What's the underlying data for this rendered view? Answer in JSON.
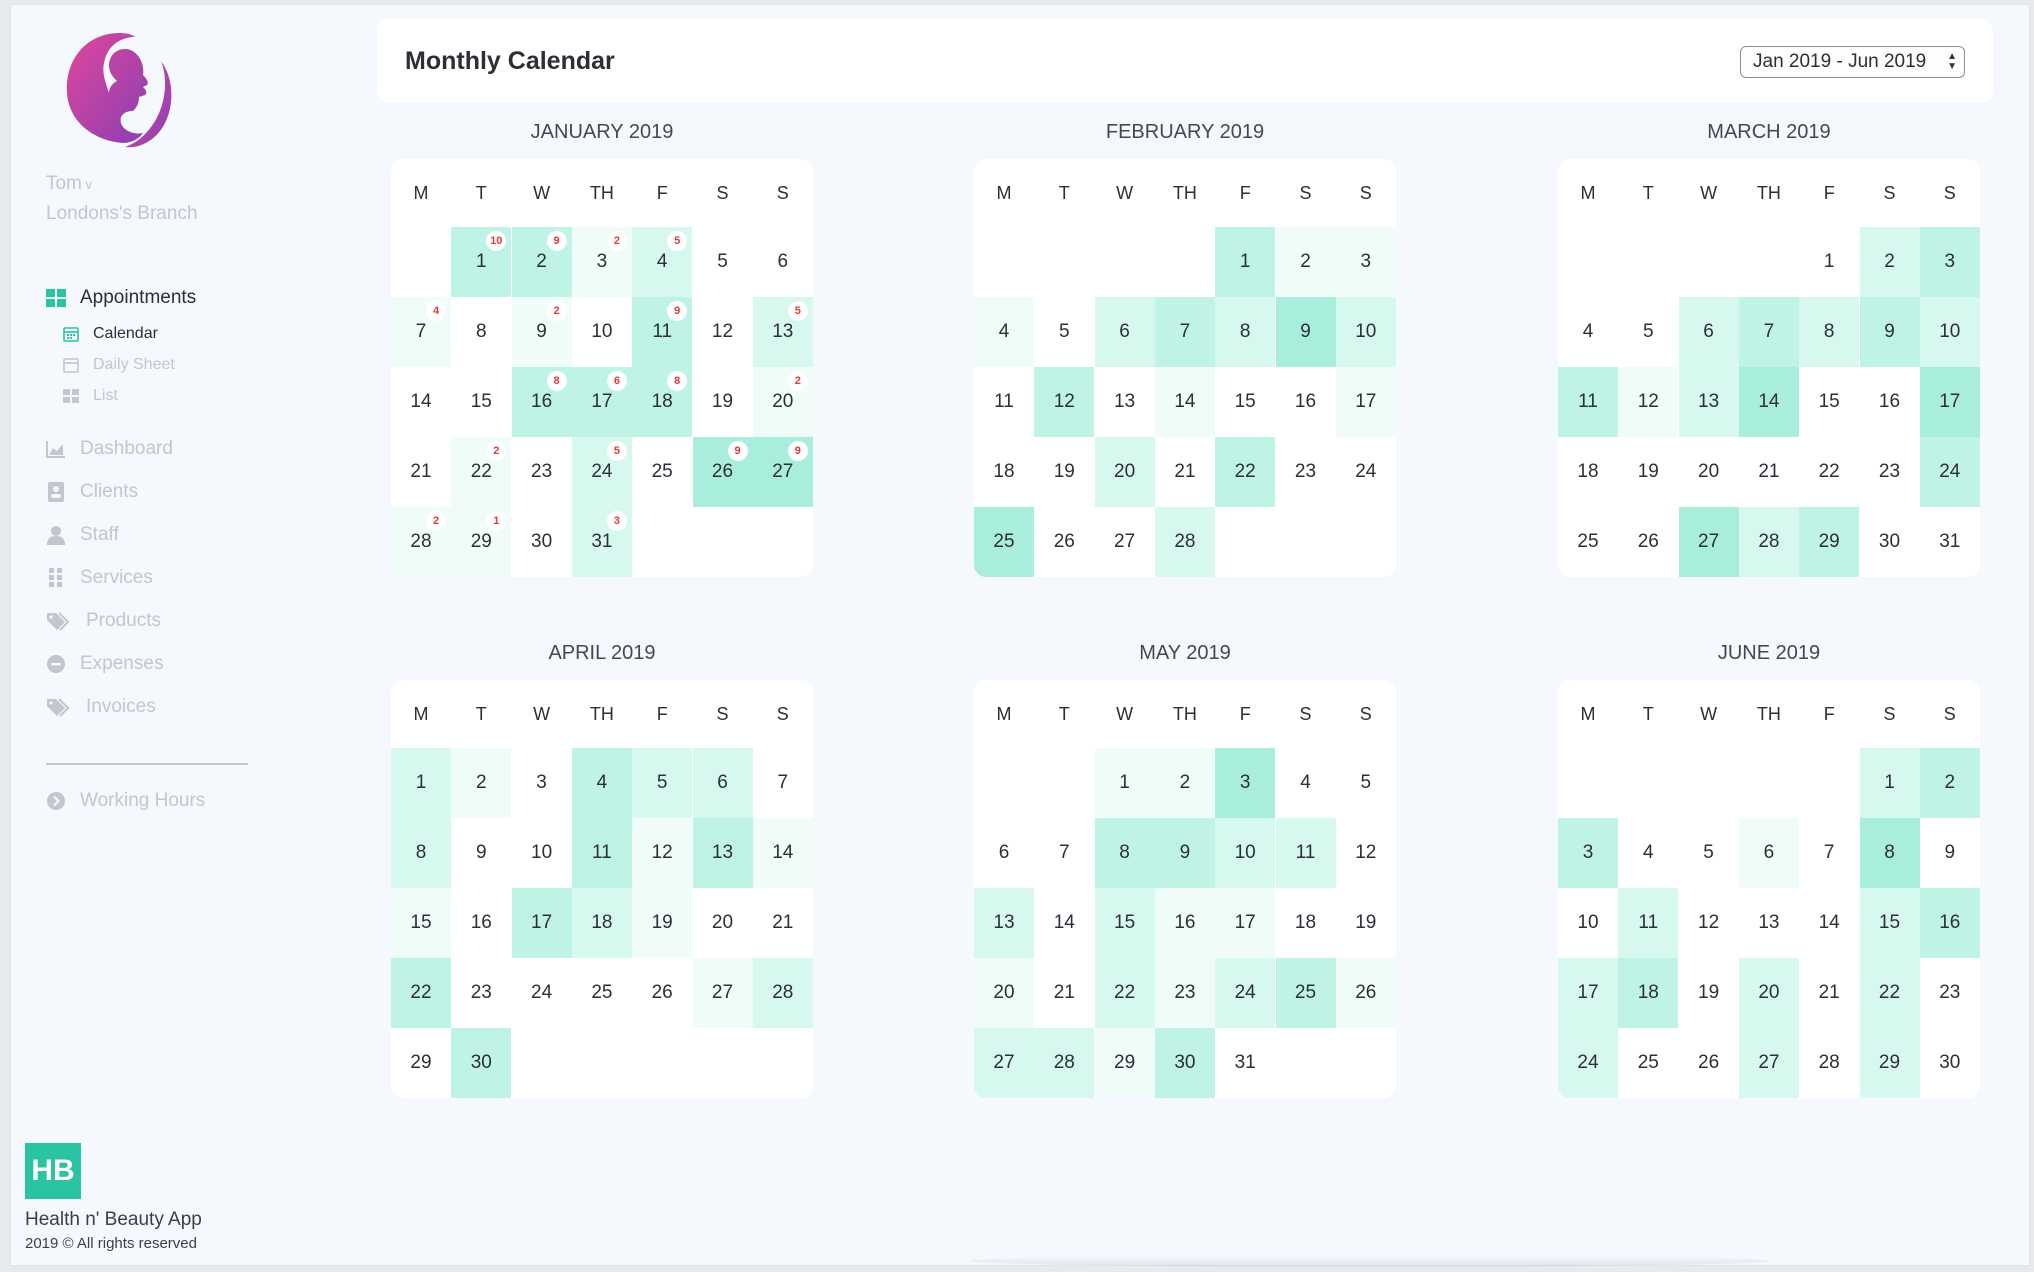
{
  "sidebar": {
    "user": "Tom",
    "branch": "Londons's Branch",
    "nav": {
      "appointments": "Appointments",
      "calendar": "Calendar",
      "daily_sheet": "Daily Sheet",
      "list": "List",
      "dashboard": "Dashboard",
      "clients": "Clients",
      "staff": "Staff",
      "services": "Services",
      "products": "Products",
      "expenses": "Expenses",
      "invoices": "Invoices",
      "working_hours": "Working Hours"
    },
    "brand_badge": "HB",
    "brand_name": "Health n' Beauty App",
    "copyright": "2019 © All rights reserved"
  },
  "header": {
    "title": "Monthly Calendar",
    "range": "Jan 2019 - Jun 2019"
  },
  "colors": {
    "accent": "#2bc4a2",
    "logo_start": "#e0479a",
    "logo_end": "#8a3fb5",
    "badge_text": "#e03a3a",
    "level_0": "#ffffff",
    "level_1": "#effcf8",
    "level_2": "#d6f8ef",
    "level_3": "#bff3e6",
    "level_4": "#a9eedc"
  },
  "weekday_labels": [
    "M",
    "T",
    "W",
    "TH",
    "F",
    "S",
    "S"
  ],
  "months": [
    {
      "title": "JANUARY 2019",
      "offset": 1,
      "days": 31,
      "levels": [
        3,
        3,
        1,
        2,
        0,
        0,
        1,
        0,
        1,
        0,
        3,
        0,
        2,
        0,
        0,
        3,
        3,
        3,
        0,
        1,
        0,
        1,
        0,
        2,
        0,
        4,
        4,
        1,
        1,
        0,
        2
      ],
      "badges": {
        "1": "10",
        "2": "9",
        "3": "2",
        "4": "5",
        "7": "4",
        "9": "2",
        "11": "9",
        "13": "5",
        "16": "8",
        "17": "6",
        "18": "8",
        "20": "2",
        "22": "2",
        "24": "5",
        "26": "9",
        "27": "9",
        "28": "2",
        "29": "1",
        "31": "3"
      }
    },
    {
      "title": "FEBRUARY 2019",
      "offset": 4,
      "days": 28,
      "levels": [
        3,
        1,
        1,
        1,
        0,
        2,
        3,
        2,
        4,
        2,
        0,
        3,
        0,
        1,
        0,
        0,
        1,
        0,
        0,
        2,
        0,
        3,
        0,
        0,
        4,
        0,
        0,
        2
      ]
    },
    {
      "title": "MARCH 2019",
      "offset": 4,
      "days": 31,
      "levels": [
        0,
        2,
        3,
        0,
        0,
        2,
        3,
        2,
        3,
        2,
        3,
        1,
        2,
        4,
        0,
        0,
        4,
        0,
        0,
        0,
        0,
        0,
        0,
        3,
        0,
        0,
        4,
        2,
        3,
        0,
        0
      ]
    },
    {
      "title": "APRIL 2019",
      "offset": 0,
      "days": 30,
      "levels": [
        2,
        1,
        0,
        3,
        2,
        2,
        0,
        2,
        0,
        0,
        3,
        1,
        3,
        1,
        1,
        0,
        3,
        2,
        1,
        0,
        0,
        3,
        0,
        0,
        0,
        0,
        1,
        2,
        0,
        3
      ]
    },
    {
      "title": "MAY 2019",
      "offset": 2,
      "days": 31,
      "levels": [
        1,
        1,
        4,
        0,
        0,
        0,
        0,
        3,
        3,
        2,
        2,
        0,
        2,
        0,
        2,
        1,
        1,
        0,
        0,
        1,
        0,
        2,
        1,
        2,
        3,
        1,
        2,
        2,
        1,
        3,
        0
      ]
    },
    {
      "title": "JUNE 2019",
      "offset": 5,
      "days": 30,
      "levels": [
        2,
        3,
        3,
        0,
        0,
        1,
        0,
        4,
        0,
        0,
        2,
        0,
        0,
        0,
        2,
        3,
        2,
        3,
        0,
        2,
        0,
        2,
        0,
        2,
        0,
        0,
        2,
        0,
        2,
        0
      ]
    }
  ]
}
